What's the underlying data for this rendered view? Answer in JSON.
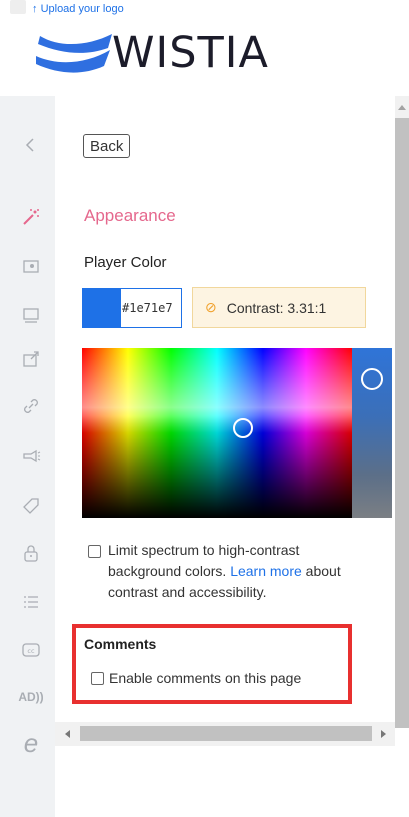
{
  "header": {
    "upload_link": "Upload your logo",
    "brand": "WISTIA"
  },
  "sidebar": {
    "items": [
      {
        "icon": "chevron-left-icon",
        "glyph": "<"
      },
      {
        "icon": "magic-wand-icon",
        "glyph": "wand"
      },
      {
        "icon": "media-icon",
        "glyph": "media"
      },
      {
        "icon": "player-icon",
        "glyph": "player"
      },
      {
        "icon": "share-icon",
        "glyph": "share"
      },
      {
        "icon": "link-icon",
        "glyph": "link"
      },
      {
        "icon": "megaphone-icon",
        "glyph": "megaphone"
      },
      {
        "icon": "tag-icon",
        "glyph": "tag"
      },
      {
        "icon": "lock-icon",
        "glyph": "lock"
      },
      {
        "icon": "list-icon",
        "glyph": "list"
      },
      {
        "icon": "closed-captions-icon",
        "glyph": "cc"
      },
      {
        "icon": "audio-description-icon",
        "glyph": "AD"
      },
      {
        "icon": "wistia-e-icon",
        "glyph": "e"
      }
    ],
    "cc_text": "cc",
    "ad_text": "AD))",
    "e_text": "e"
  },
  "panel": {
    "back_label": "Back",
    "section_title": "Appearance",
    "player_color_label": "Player Color",
    "hex_value": "#1e71e7",
    "contrast_text": "Contrast: 3.31:1",
    "limit_text": "Limit spectrum to high-contrast background colors.",
    "learn_more": "Learn more",
    "limit_text_after": "about contrast and accessibility.",
    "comments_label": "Comments",
    "enable_comments": "Enable comments on this page"
  },
  "colors": {
    "accent": "#1e71e7",
    "section_title": "#e5688d",
    "highlight_border": "#e8302f"
  }
}
